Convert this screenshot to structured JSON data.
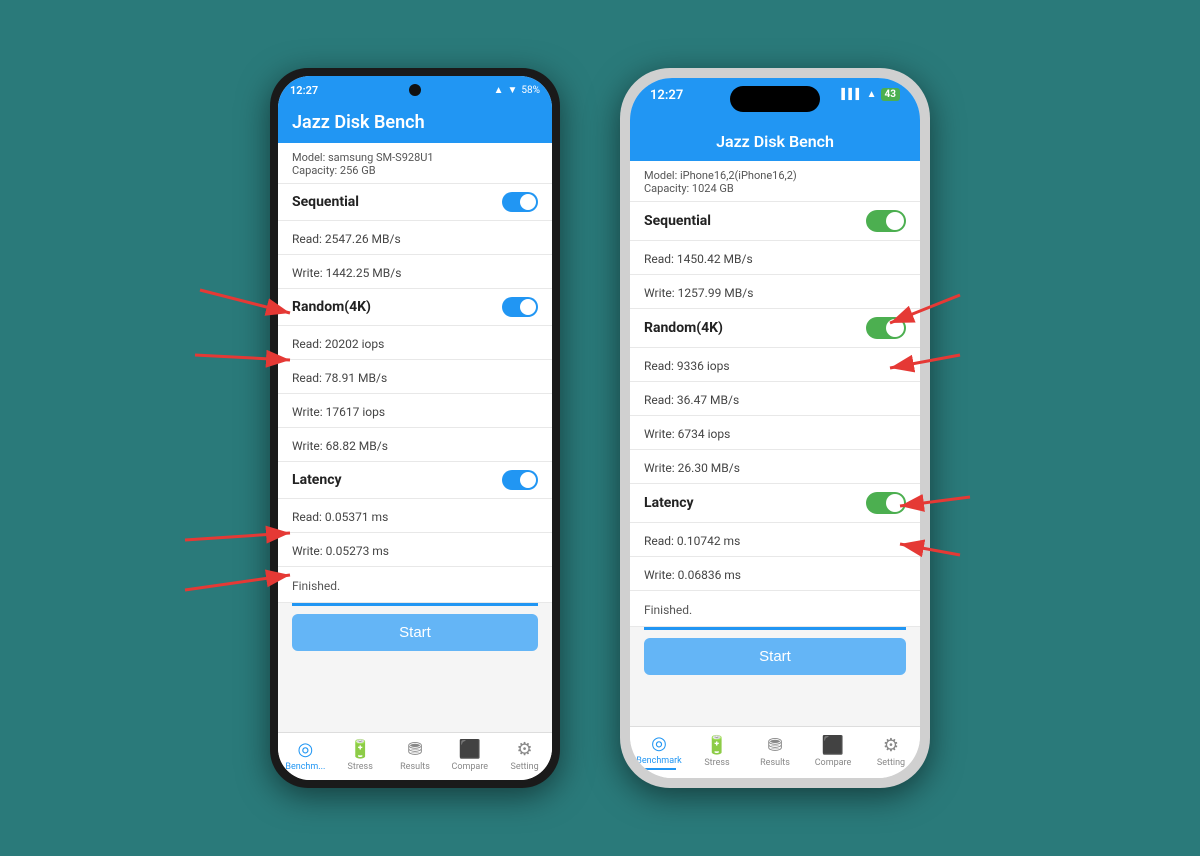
{
  "background_color": "#2a7a7a",
  "android": {
    "status_time": "12:27",
    "status_icons": "⌫⊟● 58%",
    "app_title": "Jazz Disk Bench",
    "device_model": "Model: samsung SM-S928U1",
    "device_capacity": "Capacity: 256 GB",
    "sequential_label": "Sequential",
    "seq_read": "Read: 2547.26 MB/s",
    "seq_write": "Write: 1442.25 MB/s",
    "random4k_label": "Random(4K)",
    "rand_read_iops": "Read: 20202 iops",
    "rand_read_mb": "Read: 78.91 MB/s",
    "rand_write_iops": "Write: 17617 iops",
    "rand_write_mb": "Write: 68.82 MB/s",
    "latency_label": "Latency",
    "lat_read": "Read: 0.05371 ms",
    "lat_write": "Write: 0.05273 ms",
    "finished": "Finished.",
    "start_btn": "Start",
    "nav": {
      "benchmark": "Benchm...",
      "stress": "Stress",
      "results": "Results",
      "compare": "Compare",
      "setting": "Setting"
    }
  },
  "iphone": {
    "status_time": "12:27",
    "battery_label": "43",
    "app_title": "Jazz Disk Bench",
    "device_model": "Model: iPhone16,2(iPhone16,2)",
    "device_capacity": "Capacity: 1024 GB",
    "sequential_label": "Sequential",
    "seq_read": "Read: 1450.42 MB/s",
    "seq_write": "Write: 1257.99 MB/s",
    "random4k_label": "Random(4K)",
    "rand_read_iops": "Read: 9336 iops",
    "rand_read_mb": "Read: 36.47 MB/s",
    "rand_write_iops": "Write: 6734 iops",
    "rand_write_mb": "Write: 26.30 MB/s",
    "latency_label": "Latency",
    "lat_read": "Read: 0.10742 ms",
    "lat_write": "Write: 0.06836 ms",
    "finished": "Finished.",
    "start_btn": "Start",
    "nav": {
      "benchmark": "Benchmark",
      "stress": "Stress",
      "results": "Results",
      "compare": "Compare",
      "setting": "Setting"
    }
  }
}
